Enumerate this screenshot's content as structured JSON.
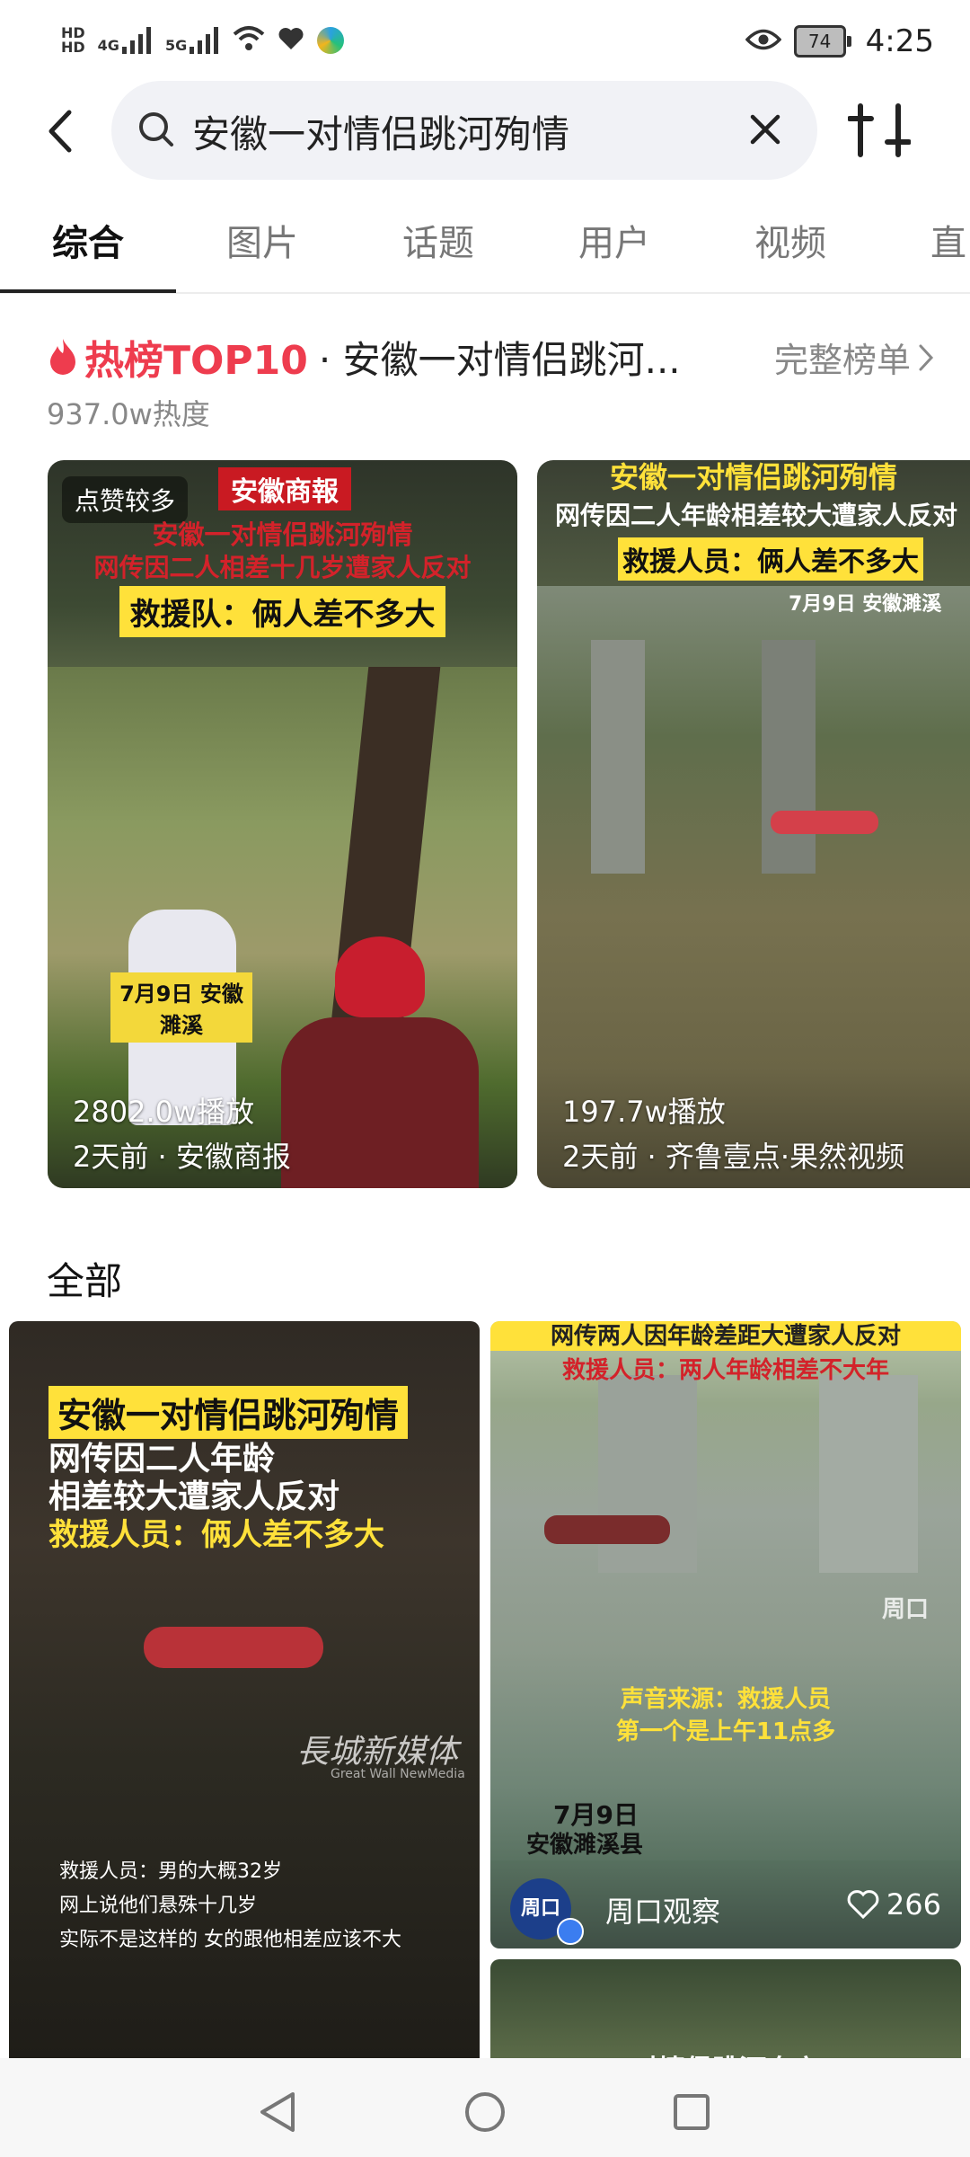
{
  "status": {
    "time": "4:25",
    "battery": "74",
    "signal_left": "4G",
    "signal_right": "5G"
  },
  "search": {
    "query": "安徽一对情侣跳河殉情"
  },
  "tabs": [
    "综合",
    "图片",
    "话题",
    "用户",
    "视频",
    "直"
  ],
  "hot": {
    "badge": "热榜TOP10",
    "topic": "· 安徽一对情侣跳河...",
    "more": "完整榜单",
    "heat": "937.0w热度"
  },
  "cards": [
    {
      "tag": "点赞较多",
      "brand": "安徽商報",
      "cap1": "安徽一对情侣跳河殉情",
      "cap2": "网传因二人相差十几岁遭家人反对",
      "cap3": "救援队：俩人差不多大",
      "stamp": "7月9日 安徽濉溪",
      "plays": "2802.0w播放",
      "meta": "2天前 · 安徽商报"
    },
    {
      "cap1": "安徽一对情侣跳河殉情",
      "cap2": "网传因二人年龄相差较大遭家人反对",
      "cap3": "救援人员：俩人差不多大",
      "stamp": "7月9日 安徽濉溪",
      "plays": "197.7w播放",
      "meta": "2天前 · 齐鲁壹点·果然视频"
    }
  ],
  "section_all": "全部",
  "feed": [
    {
      "cap1": "安徽一对情侣跳河殉情",
      "cap2": "网传因二人年龄",
      "cap3": "相差较大遭家人反对",
      "cap4": "救援人员：俩人差不多大",
      "watermark": "長城新媒体",
      "watermark_en": "Great Wall NewMedia",
      "sub1": "救援人员：男的大概32岁",
      "sub2": "网上说他们悬殊十几岁",
      "sub3": "实际不是这样的 女的跟他相差应该不大"
    },
    {
      "cap1": "网传两人因年龄差距大遭家人反对",
      "cap2": "救援人员：两人年龄相差不大年",
      "sub1": "声音来源：救援人员",
      "sub2": "第一个是上午11点多",
      "stamp1": "7月9日",
      "stamp2": "安徽濉溪县",
      "author": "周口观察",
      "likes": "266",
      "logo": "周口"
    },
    {
      "cap1": "对情侣跳河身亡"
    }
  ],
  "colors": {
    "accent": "#ee3c4e",
    "caption_yellow": "#ffe13a",
    "caption_red": "#d3222a"
  }
}
